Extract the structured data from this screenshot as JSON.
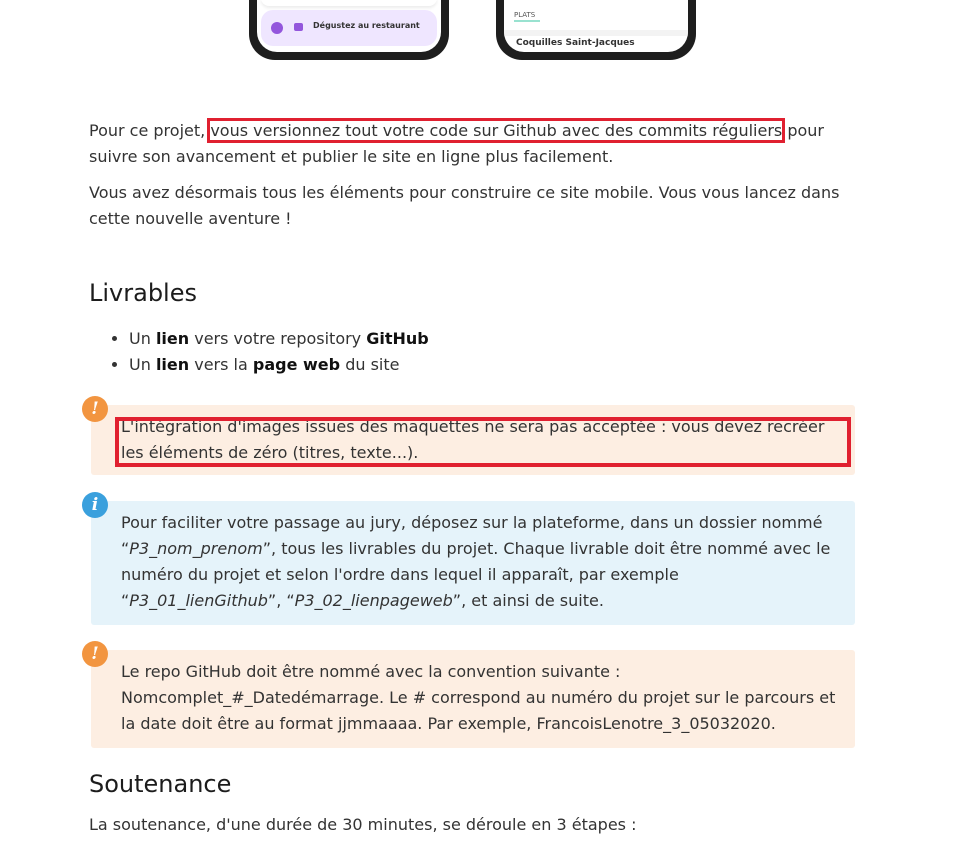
{
  "phones": {
    "left_pill_label": "Dégustez au restaurant",
    "right_section_tag": "PLATS",
    "right_dish_name": "Coquilles Saint-Jacques"
  },
  "intro": {
    "p1_before": "Pour ce projet, ",
    "p1_highlight": "vous versionnez tout votre code sur Github avec des commits réguliers",
    "p1_after": " pour suivre son avancement et publier le site en ligne plus facilement.",
    "p2": "Vous avez désormais tous les éléments pour construire ce site mobile. Vous vous lancez dans cette nouvelle aventure !"
  },
  "livrables": {
    "title": "Livrables",
    "items": [
      {
        "a": "Un ",
        "b": "lien",
        "c": " vers votre repository ",
        "d": "GitHub",
        "e": ""
      },
      {
        "a": "Un ",
        "b": "lien",
        "c": " vers la ",
        "d": "page web",
        "e": " du site"
      }
    ]
  },
  "notes": {
    "warning1": "L'intégration d'images issues des maquettes ne sera pas acceptée : vous devez recréer les éléments de zéro (titres, texte...).",
    "info_parts": [
      "Pour faciliter votre passage au jury, déposez sur la plateforme, dans un dossier nommé “",
      "P3_nom_prenom",
      "”, tous les livrables du projet. Chaque livrable doit être nommé avec le numéro du projet et selon l'ordre dans lequel il apparaît, par exemple “",
      "P3_01_lienGithub",
      "”, “",
      "P3_02_lienpageweb",
      "”, et ainsi de suite."
    ],
    "warning2": "Le repo GitHub doit être nommé avec la convention suivante : Nomcomplet_#_Datedémarrage. Le # correspond au numéro du projet sur le parcours et la date doit être au format jjmmaaaa. Par exemple, FrancoisLenotre_3_05032020.",
    "badge_warn": "!",
    "badge_info": "i"
  },
  "soutenance": {
    "title": "Soutenance",
    "text": "La soutenance, d'une durée de 30 minutes,  se déroule en 3 étapes :"
  },
  "colors": {
    "highlight_frame": "#e02030",
    "warn_bg": "#fdeee2",
    "info_bg": "#e5f3fa",
    "warn_badge": "#f29540",
    "info_badge": "#3aa0dd"
  }
}
